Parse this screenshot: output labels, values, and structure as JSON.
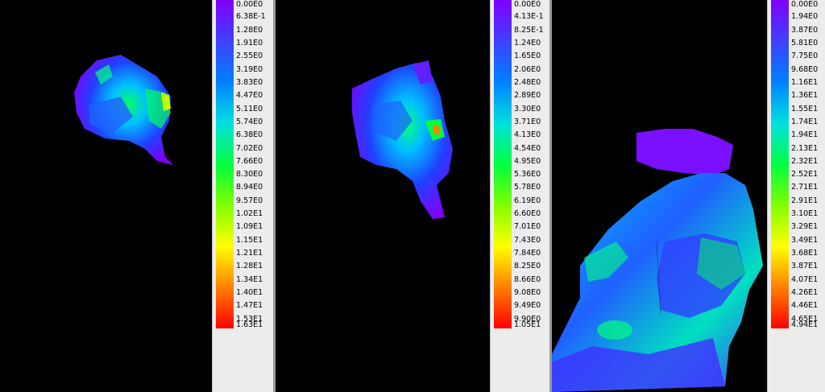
{
  "legends": [
    {
      "labels": [
        "0.00E0",
        "6.38E-1",
        "1.28E0",
        "1.91E0",
        "2.55E0",
        "3.19E0",
        "3.83E0",
        "4.47E0",
        "5.11E0",
        "5.74E0",
        "6.38E0",
        "7.02E0",
        "7.66E0",
        "8.30E0",
        "8.94E0",
        "9.57E0",
        "1.02E1",
        "1.09E1",
        "1.15E1",
        "1.21E1",
        "1.28E1",
        "1.34E1",
        "1.40E1",
        "1.47E1",
        "1.53E1",
        "1.63E1"
      ]
    },
    {
      "labels": [
        "0.00E0",
        "4.13E-1",
        "8.25E-1",
        "1.24E0",
        "1.65E0",
        "2.06E0",
        "2.48E0",
        "2.89E0",
        "3.30E0",
        "3.71E0",
        "4.13E0",
        "4.54E0",
        "4.95E0",
        "5.36E0",
        "5.78E0",
        "6.19E0",
        "6.60E0",
        "7.01E0",
        "7.43E0",
        "7.84E0",
        "8.25E0",
        "8.66E0",
        "9.08E0",
        "9.49E0",
        "9.90E0",
        "1.05E1"
      ]
    },
    {
      "labels": [
        "0.00E0",
        "1.94E0",
        "3.87E0",
        "5.81E0",
        "7.75E0",
        "9.68E0",
        "1.16E1",
        "1.36E1",
        "1.55E1",
        "1.74E1",
        "1.94E1",
        "2.13E1",
        "2.32E1",
        "2.52E1",
        "2.71E1",
        "2.91E1",
        "3.10E1",
        "3.29E1",
        "3.49E1",
        "3.68E1",
        "3.87E1",
        "4.07E1",
        "4.26E1",
        "4.46E1",
        "4.65E1",
        "4.94E1"
      ]
    }
  ],
  "colors": {
    "scale": [
      "#8000ff",
      "#4040ff",
      "#0080ff",
      "#00e0e0",
      "#00ff40",
      "#80ff00",
      "#ffff00",
      "#ff8000",
      "#ff0000"
    ],
    "background": "#000000",
    "legend_bg": "#ececec"
  }
}
